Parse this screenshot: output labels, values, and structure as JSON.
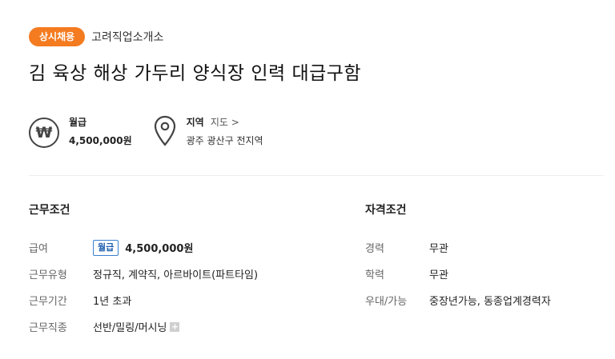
{
  "header": {
    "badge": "상시채용",
    "company": "고려직업소개소",
    "title": "김 육상 해상 가두리 양식장 인력 대급구함"
  },
  "summary": {
    "salary": {
      "icon": "won-icon",
      "label": "월급",
      "value": "4,500,000원"
    },
    "location": {
      "icon": "map-pin-icon",
      "label": "지역",
      "map_link": "지도 >",
      "value": "광주 광산구 전지역"
    }
  },
  "work_conditions": {
    "title": "근무조건",
    "rows": [
      {
        "label": "급여",
        "tag": "월급",
        "value": "4,500,000원"
      },
      {
        "label": "근무유형",
        "value": "정규직, 계약직, 아르바이트(파트타임)"
      },
      {
        "label": "근무기간",
        "value": "1년 초과"
      },
      {
        "label": "근무직종",
        "value": "선반/밀링/머시닝",
        "more": "+"
      }
    ]
  },
  "qualifications": {
    "title": "자격조건",
    "rows": [
      {
        "label": "경력",
        "value": "무관"
      },
      {
        "label": "학력",
        "value": "무관"
      },
      {
        "label": "우대/가능",
        "value": "중장년가능, 동종업계경력자"
      }
    ]
  },
  "colors": {
    "badge": "#f47b20",
    "tag_border": "#3a7fd0",
    "text": "#222222"
  }
}
